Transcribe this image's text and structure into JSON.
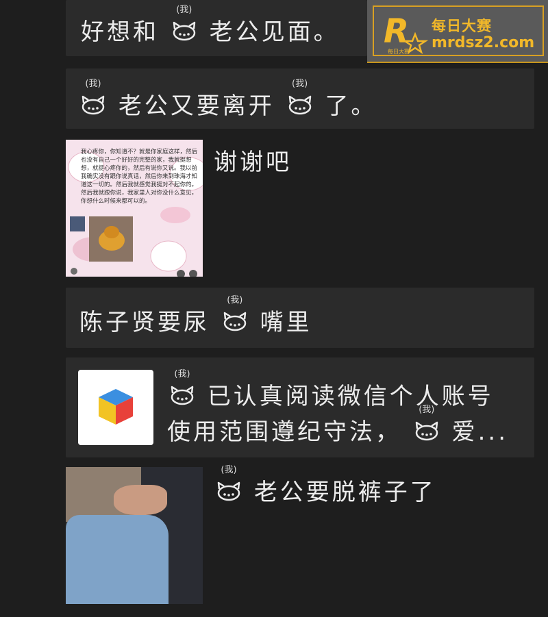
{
  "watermark": {
    "brand_cn": "每日大赛",
    "url": "mrdsz2.com",
    "logo_letter": "R",
    "logo_sub": "每日大赛"
  },
  "kitty_label": "(我)",
  "messages": [
    {
      "id": "m1",
      "before": "好想和",
      "after": "老公见面。"
    },
    {
      "id": "m2",
      "before": "",
      "middle": "老公又要离开",
      "after": "了。"
    },
    {
      "id": "m3",
      "text": "谢谢吧",
      "thumb_text": "我心疼你，你知道不？就是你家庭这样，然后也没有自己一个好好的完整的家，我就挺想想，就挺心疼你的，然后有说你又说。我以前我确实没有跟你说真话，然后你来到珠海才知道这一切的。然后我就感觉我挺对不起你的。然后我就跟你说，我家里人对你没什么意见，你想什么时候来都可以的。"
    },
    {
      "id": "m4",
      "before": "陈子贤要尿",
      "after": "嘴里"
    },
    {
      "id": "m5",
      "line1_after": "已认真阅读微信个人账号",
      "line2_before": "使用范围遵纪守法，",
      "line2_after": "爱..."
    },
    {
      "id": "m6",
      "after": "老公要脱裤子了"
    }
  ],
  "colors": {
    "background": "#1e1e1e",
    "card": "#2b2b2b",
    "text": "#ececec",
    "watermark_gold": "#f2b829"
  }
}
